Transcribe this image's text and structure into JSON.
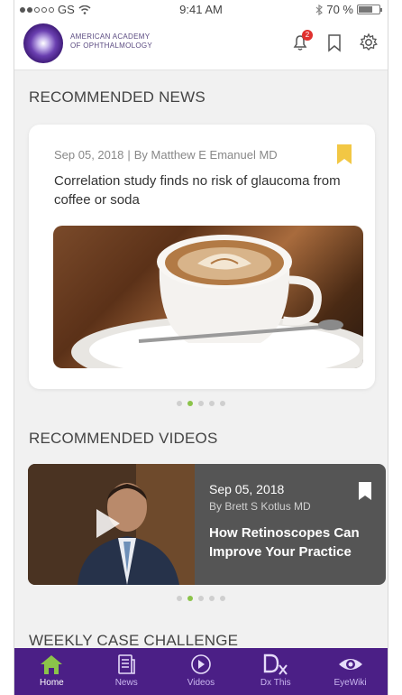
{
  "status_bar": {
    "carrier": "GS",
    "time": "9:41 AM",
    "battery": "70 %",
    "battery_level": 0.7
  },
  "header": {
    "logo_line1": "AMERICAN ACADEMY",
    "logo_line2": "OF OPHTHALMOLOGY",
    "notification_count": "2"
  },
  "news": {
    "section_title": "RECOMMENDED NEWS",
    "date": "Sep 05, 2018",
    "separator": "|",
    "author": "By Matthew E Emanuel MD",
    "headline": "Correlation study finds no risk of glaucoma from coffee or soda",
    "pages": 5,
    "active_page": 2
  },
  "videos": {
    "section_title": "RECOMMENDED VIDEOS",
    "date": "Sep 05, 2018",
    "author": "By Brett S Kotlus MD",
    "title": "How Retinoscopes Can Improve Your Practice",
    "pages": 5,
    "active_page": 2
  },
  "weekly": {
    "section_title": "WEEKLY CASE CHALLENGE"
  },
  "bottom_nav": [
    {
      "label": "Home",
      "icon": "home-icon",
      "active": true
    },
    {
      "label": "News",
      "icon": "news-icon",
      "active": false
    },
    {
      "label": "Videos",
      "icon": "video-play-icon",
      "active": false
    },
    {
      "label": "Dx This",
      "icon": "dx-icon",
      "active": false
    },
    {
      "label": "EyeWiki",
      "icon": "eye-icon",
      "active": false
    }
  ],
  "colors": {
    "accent_yellow": "#f2c744",
    "nav_purple": "#4b1f86",
    "active_green": "#8bc34a",
    "badge_red": "#e0312f"
  }
}
